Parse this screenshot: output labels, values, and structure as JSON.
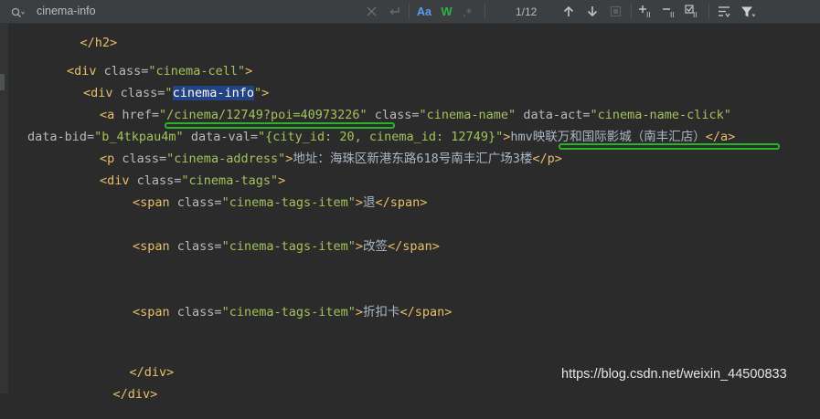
{
  "search": {
    "value": "cinema-info",
    "match_count": "1/12",
    "case_label": "Aa",
    "words_label": "W",
    "colors": {
      "case_active": "#589df6",
      "words_active": "#2bb547"
    }
  },
  "toolbar": {
    "icons": [
      "search-icon",
      "clear-icon",
      "new-line-icon",
      "match-case-icon",
      "words-icon",
      "regex-icon",
      "previous-occurrence-icon",
      "next-occurrence-icon",
      "find-all-icon",
      "add-selection-icon",
      "unselect-occurrence-icon",
      "select-all-occurrences-icon",
      "filter-search-results-icon",
      "filter-icon"
    ]
  },
  "code": {
    "l1": "</h2>",
    "l2": {
      "tag_open": "<div ",
      "attr": "class=",
      "val": "\"cinema-cell\"",
      "tag_close": ">"
    },
    "l3": {
      "tag_open": "<div ",
      "attr": "class=",
      "q1": "\"",
      "match": "cinema-info",
      "q2": "\"",
      "tag_close": ">"
    },
    "l4": {
      "tag_open": "<a ",
      "attr1": "href=",
      "val1": "\"/cinema/12749?poi=40973226\"",
      "attr2": " class=",
      "val2": "\"cinema-name\"",
      "attr3": " data-act=",
      "val3": "\"cinema-name-click\""
    },
    "l5": {
      "attr1": "data-bid=",
      "val1": "\"b_4tkpau4m\"",
      "attr2": " data-val=",
      "val2": "\"{city_id: 20, cinema_id: 12749}\"",
      "tag_mid": ">",
      "text": "hmv映联万和国际影城（南丰汇店）",
      "tag_close": "</a>"
    },
    "l6": {
      "tag_open": "<p ",
      "attr": "class=",
      "val": "\"cinema-address\"",
      "tag_mid": ">",
      "text": "地址：海珠区新港东路618号南丰汇广场3楼",
      "tag_close": "</p>"
    },
    "l7": {
      "tag_open": "<div ",
      "attr": "class=",
      "val": "\"cinema-tags\"",
      "tag_close": ">"
    },
    "l8": {
      "tag_open": "<span ",
      "attr": "class=",
      "val": "\"cinema-tags-item\"",
      "tag_mid": ">",
      "text": "退",
      "tag_close": "</span>"
    },
    "l9": {
      "tag_open": "<span ",
      "attr": "class=",
      "val": "\"cinema-tags-item\"",
      "tag_mid": ">",
      "text": "改签",
      "tag_close": "</span>"
    },
    "l10": {
      "tag_open": "<span ",
      "attr": "class=",
      "val": "\"cinema-tags-item\"",
      "tag_mid": ">",
      "text": "折扣卡",
      "tag_close": "</span>"
    },
    "l11": "</div>",
    "l12": "</div>"
  },
  "watermark": "https://blog.csdn.net/weixin_44500833"
}
